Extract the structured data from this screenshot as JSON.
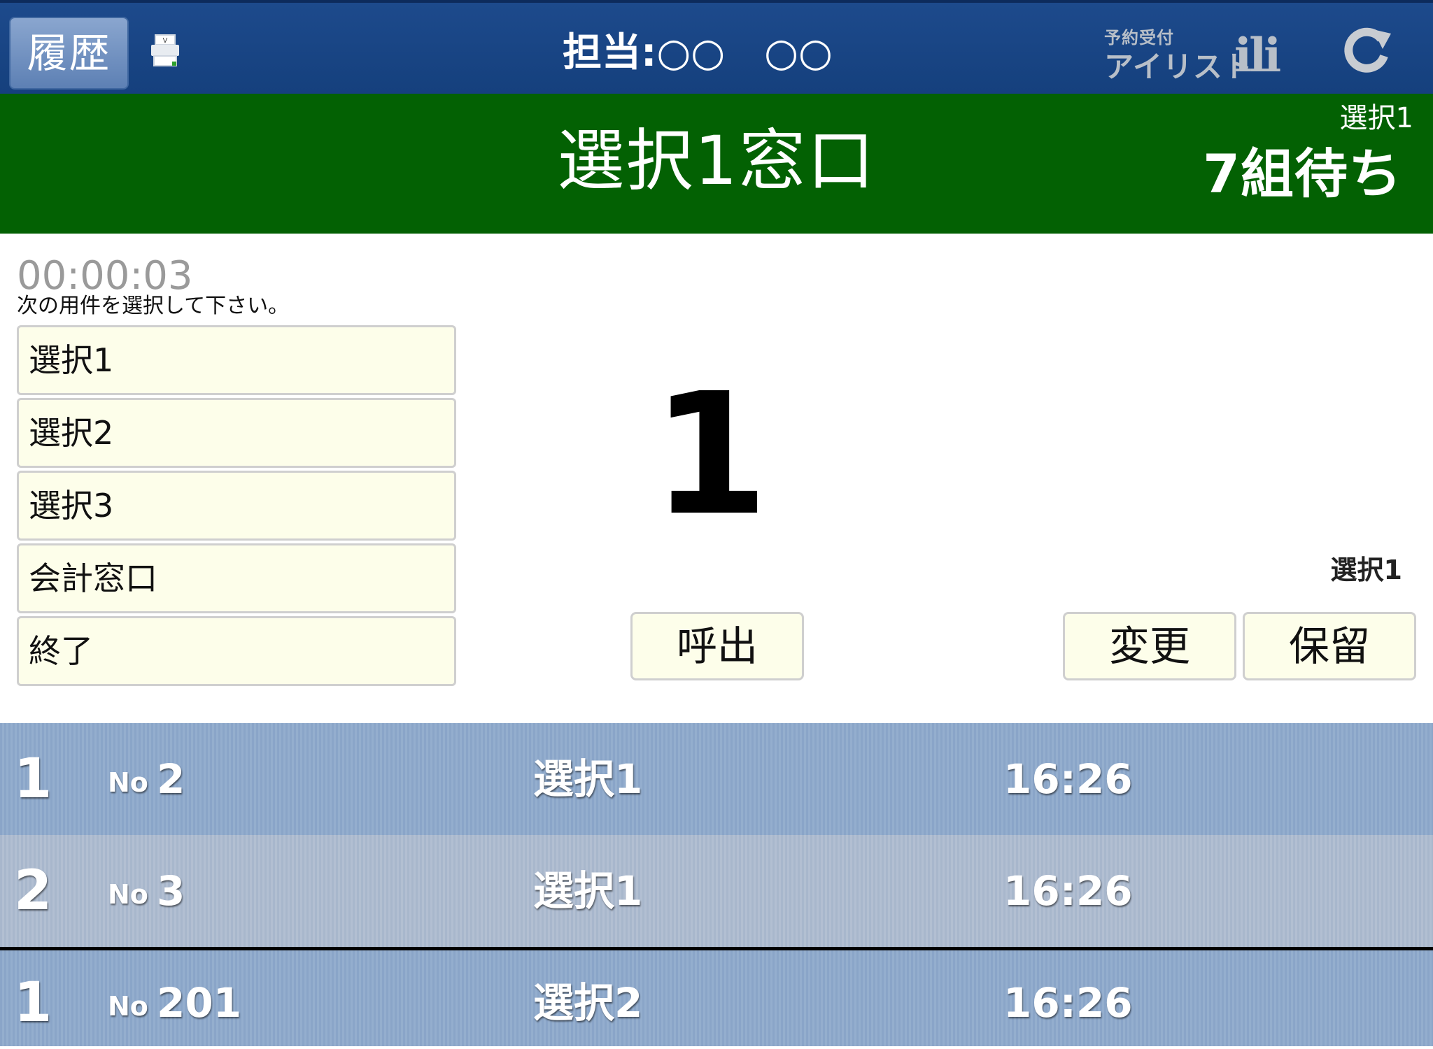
{
  "topbar": {
    "history_label": "履歴",
    "staff_text": "担当:○○　○○",
    "brand_small": "予約受付",
    "brand_big": "アイリスト",
    "brand_mark": "ili",
    "icons": [
      "printer-icon",
      "refresh-icon"
    ]
  },
  "header": {
    "window_title": "選択1窓口",
    "wait_category": "選択1",
    "wait_count": "7組待ち",
    "background_color": "#036103"
  },
  "main": {
    "timer": "00:00:03",
    "instruction": "次の用件を選択して下さい。",
    "selections": [
      "選択1",
      "選択2",
      "選択3",
      "会計窓口",
      "終了"
    ],
    "ticket_number": "1",
    "ticket_category": "選択1",
    "call_label": "呼出",
    "change_label": "変更",
    "hold_label": "保留"
  },
  "queue": [
    {
      "rank": "1",
      "no_label": "No",
      "no": "2",
      "category": "選択1",
      "time": "16:26"
    },
    {
      "rank": "2",
      "no_label": "No",
      "no": "3",
      "category": "選択1",
      "time": "16:26"
    },
    {
      "rank": "1",
      "no_label": "No",
      "no": "201",
      "category": "選択2",
      "time": "16:26"
    }
  ],
  "colors": {
    "topbar": "#15407d",
    "header": "#036103",
    "button_bg": "#fdfeea",
    "queue_row": "#8aa5c8",
    "queue_row_alt": "#a8b7cc"
  }
}
